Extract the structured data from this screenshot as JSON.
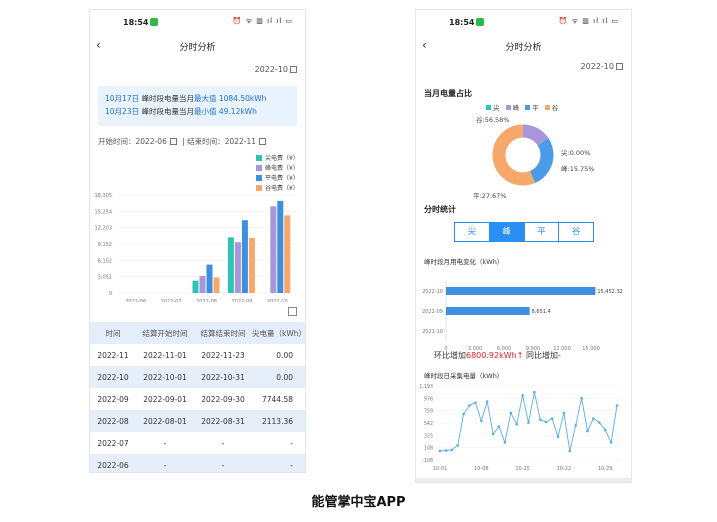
{
  "status": {
    "time": "18:54",
    "icons": "⏰ ᯤ ▥ ıl ıl ▭"
  },
  "left": {
    "back": "‹",
    "title": "分时分析",
    "month": "2022-10",
    "info": {
      "line1_date": "10月17日",
      "line1_text": " 峰时段电量当月",
      "line1_hl": "最大值 1084.50kWh",
      "line2_date": "10月23日",
      "line2_text": " 峰时段电量当月",
      "line2_hl": "最小值 49.12kWh"
    },
    "range": {
      "start_label": "开始时间：",
      "start": "2022-06",
      "sep": "|",
      "end_label": "结束时间：",
      "end": "2022-11"
    },
    "table": {
      "headers": [
        "时间",
        "结算开始时间",
        "结算结束时间",
        "尖电量（kWh）"
      ],
      "rows": [
        [
          "2022-11",
          "2022-11-01",
          "2022-11-23",
          "0.00"
        ],
        [
          "2022-10",
          "2022-10-01",
          "2022-10-31",
          "0.00"
        ],
        [
          "2022-09",
          "2022-09-01",
          "2022-09-30",
          "7744.58"
        ],
        [
          "2022-08",
          "2022-08-01",
          "2022-08-31",
          "2113.36"
        ],
        [
          "2022-07",
          "-",
          "-",
          "-"
        ],
        [
          "2022-06",
          "-",
          "-",
          "-"
        ]
      ]
    }
  },
  "right": {
    "back": "‹",
    "title": "分时分析",
    "month": "2022-10",
    "pie_title": "当月电量占比",
    "pie_labels": {
      "jian": "尖:0.00%",
      "feng": "峰:15.75%",
      "ping": "平:27.67%",
      "gu": "谷:56.58%"
    },
    "segment_title": "分时统计",
    "segments": [
      "尖",
      "峰",
      "平",
      "谷"
    ],
    "active_segment": 1,
    "bar_title": "峰时段月用电变化（kWh）",
    "line_title": "峰时段日采集电量（kWh）",
    "compare": {
      "prefix": "环比增加",
      "value": "6800.92kWh",
      "arrow": "↑",
      "suffix": "  同比增加-"
    }
  },
  "caption": "能管掌中宝APP",
  "chart_data": [
    {
      "type": "bar",
      "categories": [
        "2022-06",
        "2022-07",
        "2022-08",
        "2022-09",
        "2022-10"
      ],
      "series": [
        {
          "name": "尖电费（¥）",
          "color": "#2ec3b5",
          "values": [
            0,
            0,
            2300,
            10400,
            0
          ]
        },
        {
          "name": "峰电费（¥）",
          "color": "#a896dc",
          "values": [
            0,
            0,
            3200,
            9500,
            16200
          ]
        },
        {
          "name": "平电费（¥）",
          "color": "#3d8fe0",
          "values": [
            0,
            0,
            5300,
            13600,
            17200
          ]
        },
        {
          "name": "谷电费（¥）",
          "color": "#f5a86a",
          "values": [
            0,
            0,
            2900,
            10300,
            14500
          ]
        }
      ],
      "yticks": [
        0,
        3051,
        6102,
        9152,
        12203,
        15254,
        18305
      ],
      "ylim": [
        0,
        18305
      ]
    },
    {
      "type": "pie",
      "categories": [
        "尖",
        "峰",
        "平",
        "谷"
      ],
      "values": [
        0.0,
        15.75,
        27.67,
        56.58
      ],
      "colors": [
        "#2ec3b5",
        "#a896dc",
        "#4b9be6",
        "#f5a86a"
      ]
    },
    {
      "type": "bar",
      "orientation": "horizontal",
      "categories": [
        "2022-10",
        "2022-09",
        "2021-10"
      ],
      "values": [
        15452.32,
        8651.4,
        0
      ],
      "value_labels": [
        "15,452.32",
        "8,651.4",
        ""
      ],
      "xticks": [
        "0",
        "3,000",
        "6,000",
        "9,000",
        "12,000",
        "15,000"
      ],
      "xlim": [
        0,
        15000
      ],
      "color": "#3d8fe0"
    },
    {
      "type": "line",
      "x": [
        "10-01",
        "10-02",
        "10-03",
        "10-04",
        "10-05",
        "10-06",
        "10-07",
        "10-08",
        "10-09",
        "10-10",
        "10-11",
        "10-12",
        "10-13",
        "10-14",
        "10-15",
        "10-16",
        "10-17",
        "10-18",
        "10-19",
        "10-20",
        "10-21",
        "10-22",
        "10-23",
        "10-24",
        "10-25",
        "10-26",
        "10-27",
        "10-28",
        "10-29",
        "10-30",
        "10-31"
      ],
      "values": [
        50,
        60,
        70,
        150,
        700,
        850,
        900,
        580,
        920,
        350,
        480,
        200,
        720,
        520,
        1030,
        550,
        1084.5,
        600,
        560,
        620,
        300,
        720,
        49.12,
        500,
        980,
        400,
        620,
        550,
        420,
        200,
        850
      ],
      "xtick_labels": [
        "10-01",
        "10-08",
        "10-15",
        "10-22",
        "10-29"
      ],
      "yticks": [
        "-108",
        "108",
        "325",
        "542",
        "759",
        "976",
        "1,193"
      ],
      "ylim": [
        -108,
        1193
      ],
      "color": "#5aaee6"
    }
  ]
}
